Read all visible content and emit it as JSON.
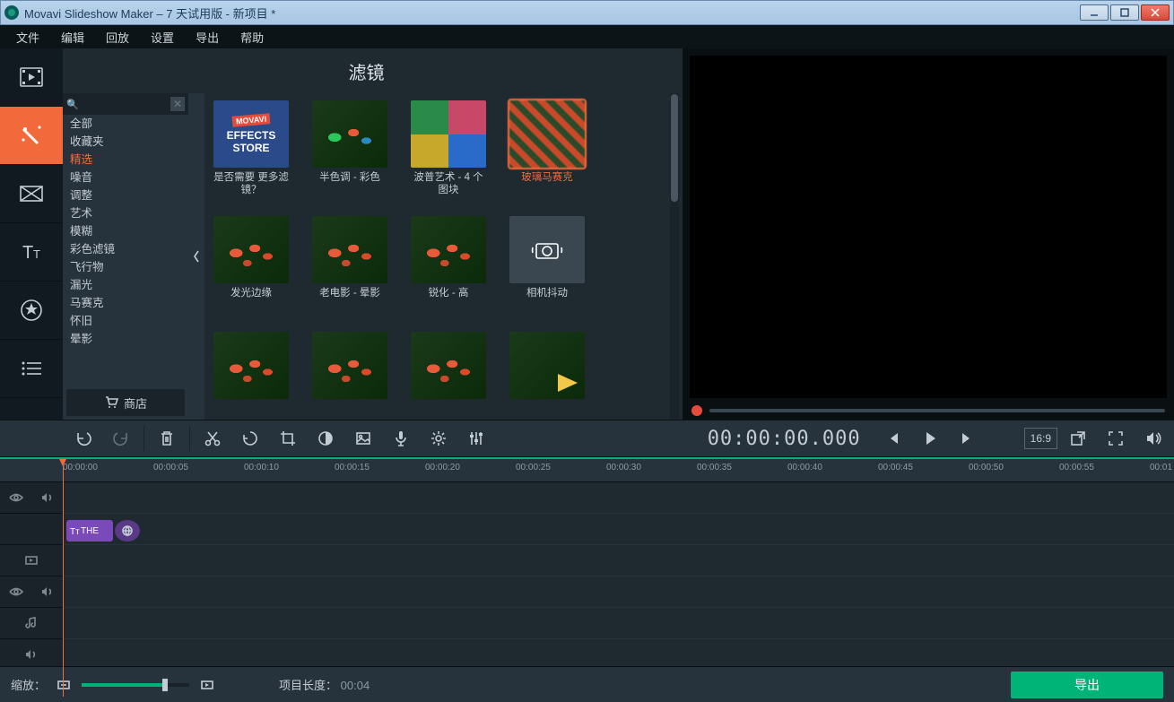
{
  "window": {
    "title": "Movavi Slideshow Maker – 7 天试用版 - 新项目 *"
  },
  "menu": {
    "items": [
      "文件",
      "编辑",
      "回放",
      "设置",
      "导出",
      "帮助"
    ]
  },
  "lefttabs": [
    {
      "name": "media-tab",
      "label": "媒体"
    },
    {
      "name": "filters-tab",
      "label": "滤镜",
      "active": true
    },
    {
      "name": "transitions-tab",
      "label": "过渡"
    },
    {
      "name": "titles-tab",
      "label": "标题"
    },
    {
      "name": "stickers-tab",
      "label": "贴纸"
    },
    {
      "name": "more-tab",
      "label": "更多"
    }
  ],
  "gallery": {
    "title": "滤镜",
    "search_placeholder": "",
    "categories": [
      "全部",
      "收藏夹",
      "精选",
      "噪音",
      "调整",
      "艺术",
      "模糊",
      "彩色滤镜",
      "飞行物",
      "漏光",
      "马赛克",
      "怀旧",
      "晕影"
    ],
    "active_category": "精选",
    "store_button": "商店",
    "thumbs": [
      {
        "label": "是否需要 更多滤镜？",
        "style": "store",
        "store_text1": "EFFECTS",
        "store_text2": "STORE",
        "store_tag": "MOVAVI"
      },
      {
        "label": "半色调 - 彩色",
        "style": "half"
      },
      {
        "label": "波普艺术 - 4 个图块",
        "style": "pop"
      },
      {
        "label": "玻璃马赛克",
        "style": "mosaic",
        "selected": true
      },
      {
        "label": "发光边缘",
        "style": "flowers"
      },
      {
        "label": "老电影 - 晕影",
        "style": "flowers"
      },
      {
        "label": "锐化 - 高",
        "style": "flowers"
      },
      {
        "label": "相机抖动",
        "style": "camera"
      },
      {
        "label": "",
        "style": "flowers"
      },
      {
        "label": "",
        "style": "flowers"
      },
      {
        "label": "",
        "style": "flowers"
      },
      {
        "label": "",
        "style": "plane"
      }
    ]
  },
  "player": {
    "timecode": "00:00:00.000",
    "aspect_ratio": "16:9"
  },
  "timeline": {
    "ruler_marks": [
      "00:00:00",
      "00:00:05",
      "00:00:10",
      "00:00:15",
      "00:00:20",
      "00:00:25",
      "00:00:30",
      "00:00:35",
      "00:00:40",
      "00:00:45",
      "00:00:50",
      "00:00:55",
      "00:01"
    ],
    "clip_title": "THE",
    "zoom_label": "缩放：",
    "project_length_label": "项目长度：",
    "project_length_value": "00:04",
    "export_label": "导出"
  }
}
